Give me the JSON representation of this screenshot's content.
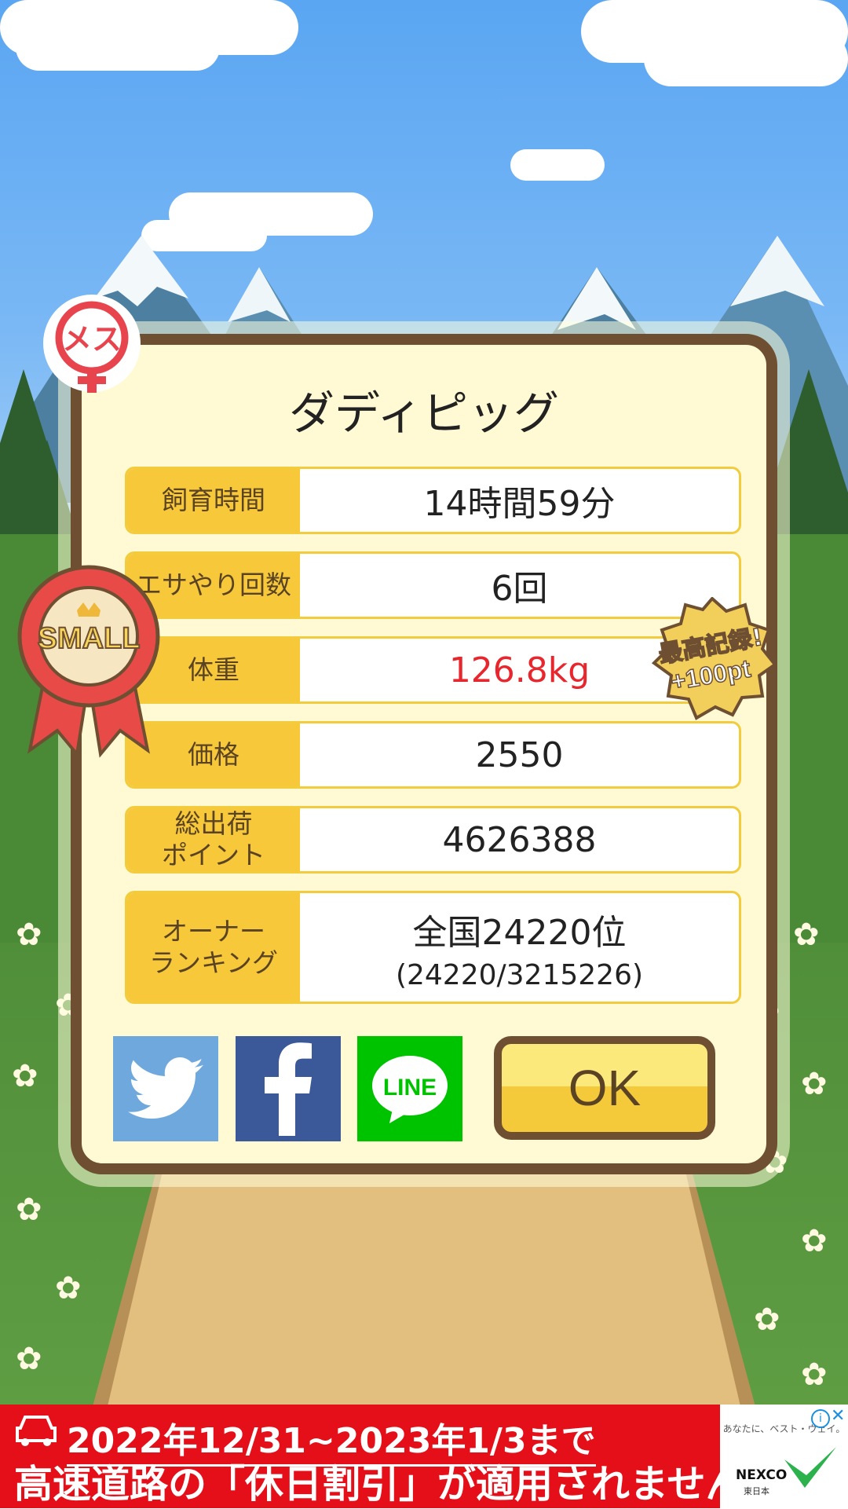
{
  "dialog": {
    "title": "ダディピッグ",
    "rows": [
      {
        "label": "飼育時間",
        "value": "14時間59分"
      },
      {
        "label": "エサやり回数",
        "value": "6回"
      },
      {
        "label": "体重",
        "value": "126.8kg",
        "highlight": "#e8262d"
      },
      {
        "label": "価格",
        "value": "2550"
      },
      {
        "label": "総出荷\nポイント",
        "value": "4626388"
      },
      {
        "label": "オーナー\nランキング",
        "value": "全国24220位",
        "sub_value": "(24220/3215226)"
      }
    ],
    "ok_label": "OK",
    "share": {
      "line_label": "LINE"
    }
  },
  "badges": {
    "gender_label": "メス",
    "size_label": "SMALL",
    "record_line1": "最高記録!",
    "record_line2": "+100pt"
  },
  "ad": {
    "line1": "2022年12/31~2023年1/3まで",
    "line2": "高速道路の「休日割引」が適用されません",
    "brand": "NEXCO",
    "brand_sub": "東日本",
    "tagline": "あなたに、ベスト・ウェイ。",
    "info_icon": "i",
    "close_icon": "✕",
    "accent": "#e40f18"
  },
  "colors": {
    "frame": "#6e4f32",
    "label_bg": "#f6c83a",
    "panel": "#fff9d4"
  }
}
